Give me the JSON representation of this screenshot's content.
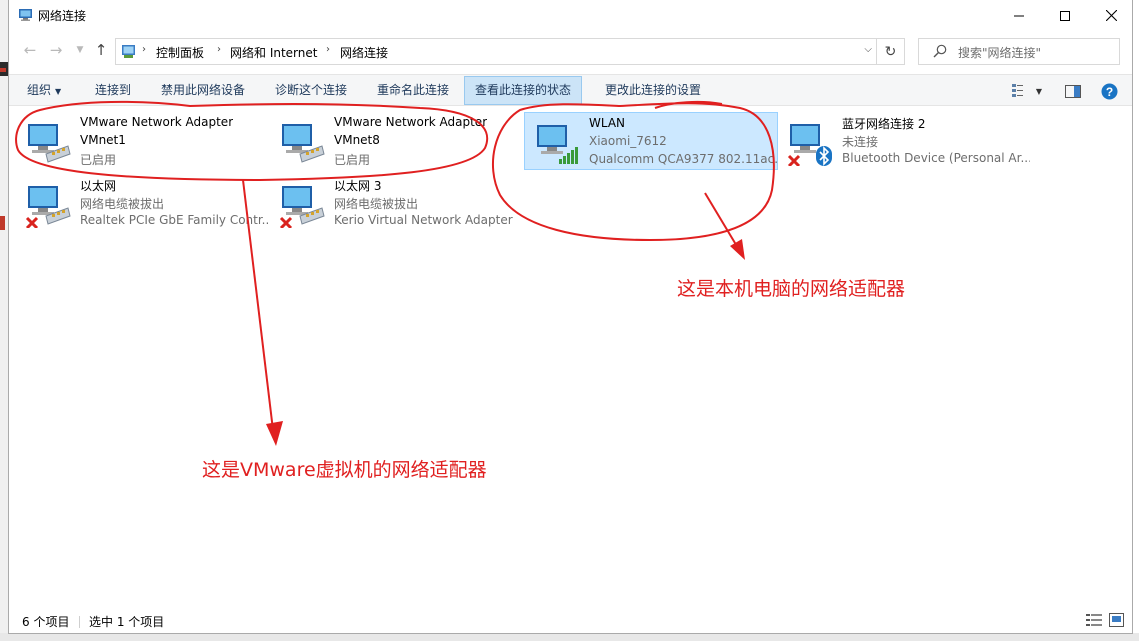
{
  "window": {
    "title": "网络连接"
  },
  "address_bar": {
    "crumbs": [
      "控制面板",
      "网络和 Internet",
      "网络连接"
    ],
    "search_placeholder": "搜索\"网络连接\""
  },
  "toolbar": {
    "organize": "组织",
    "connect_to": "连接到",
    "disable": "禁用此网络设备",
    "diagnose": "诊断这个连接",
    "rename": "重命名此连接",
    "view_status": "查看此连接的状态",
    "change_settings": "更改此连接的设置"
  },
  "connections": [
    {
      "name": "VMware Network Adapter VMnet1",
      "line1": "VMware Network Adapter",
      "line2": "VMnet1",
      "line3": "已启用",
      "status": "enabled"
    },
    {
      "name": "VMware Network Adapter VMnet8",
      "line1": "VMware Network Adapter",
      "line2": "VMnet8",
      "line3": "已启用",
      "status": "enabled"
    },
    {
      "name": "WLAN",
      "line1": "WLAN",
      "line2": "Xiaomi_7612",
      "line3": "Qualcomm QCA9377 802.11ac...",
      "status": "connected",
      "selected": true
    },
    {
      "name": "蓝牙网络连接 2",
      "line1": "蓝牙网络连接 2",
      "line2": "未连接",
      "line3": "Bluetooth Device (Personal Ar...",
      "status": "disconnected"
    },
    {
      "name": "以太网",
      "line1": "以太网",
      "line2": "网络电缆被拔出",
      "line3": "Realtek PCIe GbE Family Contr...",
      "status": "unplugged"
    },
    {
      "name": "以太网 3",
      "line1": "以太网 3",
      "line2": "网络电缆被拔出",
      "line3": "Kerio Virtual Network Adapter",
      "status": "unplugged"
    }
  ],
  "status_bar": {
    "item_count": "6 个项目",
    "selected_count": "选中 1 个项目"
  },
  "annotations": {
    "wlan_note": "这是本机电脑的网络适配器",
    "vmware_note": "这是VMware虚拟机的网络适配器",
    "color": "#e02020"
  },
  "colors": {
    "selection_bg": "#cce8ff",
    "command_text": "#1e395b",
    "link_blue": "#1a74c4"
  }
}
